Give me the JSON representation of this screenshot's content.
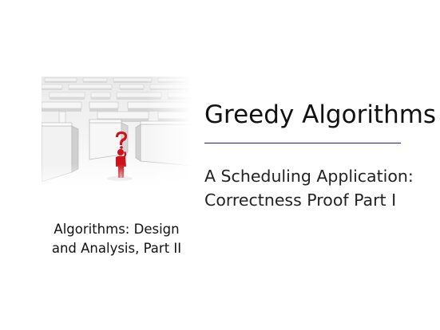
{
  "slide": {
    "title": "Greedy Algorithms",
    "subtitle_line1": "A Scheduling Application:",
    "subtitle_line2": "Correctness Proof Part I",
    "course_line1": "Algorithms: Design",
    "course_line2": "and Analysis, Part II",
    "rule_color": "#1b1bb0",
    "figure_color": "#d0101a"
  }
}
